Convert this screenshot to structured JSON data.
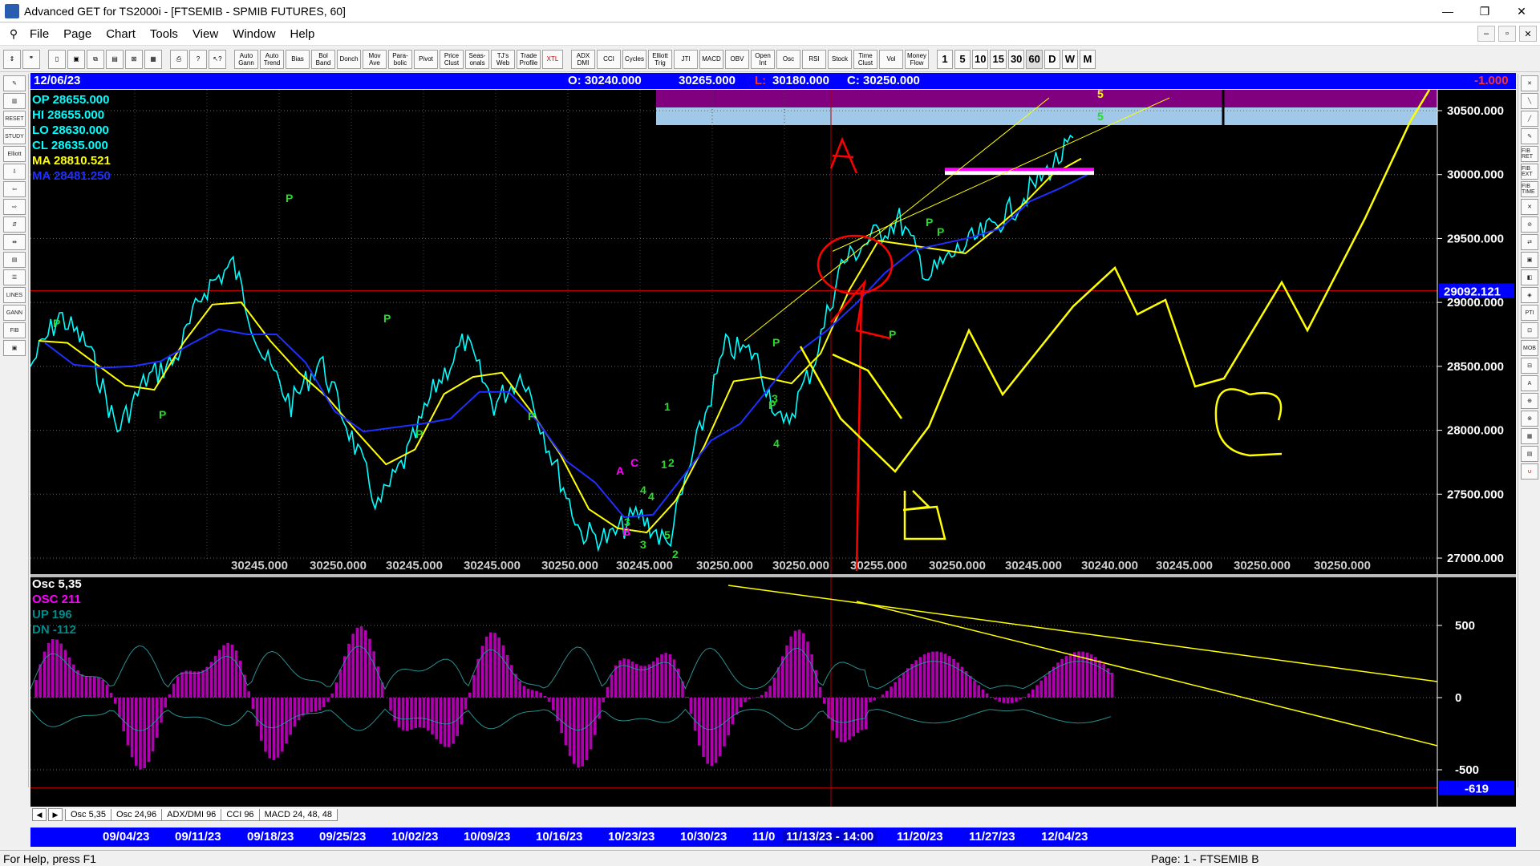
{
  "window": {
    "title": "Advanced GET for TS2000i - [FTSEMIB - SPMIB FUTURES, 60]",
    "buttons": [
      "—",
      "❐",
      "✕"
    ]
  },
  "menu": {
    "items": [
      "File",
      "Page",
      "Chart",
      "Tools",
      "View",
      "Window",
      "Help"
    ],
    "mdi_buttons": [
      "–",
      "▫",
      "✕"
    ]
  },
  "toolbar": {
    "buttons": [
      "Auto Gann",
      "Auto Trend",
      "Bias",
      "Bol Band",
      "Donch",
      "Mov Ave",
      "Para-bolic",
      "Pivot",
      "Price Clust",
      "Seas-onals",
      "TJ's Web",
      "Trade Profile",
      "XTL",
      "ADX DMI",
      "CCI",
      "Cycles",
      "Elliott Trig",
      "JTI",
      "MACD",
      "OBV",
      "Open Int",
      "Osc",
      "RSI",
      "Stock",
      "Time Clust",
      "Vol",
      "Money Flow"
    ],
    "intervals": [
      "1",
      "5",
      "10",
      "15",
      "30",
      "60",
      "D",
      "W",
      "M"
    ],
    "active_interval": "60"
  },
  "left_tools": [
    "RESET",
    "STUDY",
    "Elliott",
    "LINES",
    "GANN",
    "FIB"
  ],
  "right_tools": [
    "FIB RET",
    "FIB EXT",
    "FIB TIME",
    "PTI",
    "MOB",
    "A"
  ],
  "header": {
    "date": "12/06/23",
    "open": "O: 30240.000",
    "high": "30265.000",
    "low_label": "L:",
    "low": "30180.000",
    "close": "C: 30250.000",
    "change": "-1.000"
  },
  "readouts": {
    "op": "OP 28655.000",
    "hi": "HI  28655.000",
    "lo": "LO  28630.000",
    "cl": "CL  28635.000",
    "ma1": "MA  28810.521",
    "ma2": "MA  28481.250"
  },
  "price_axis": {
    "labels": [
      "30500.000",
      "30000.000",
      "29500.000",
      "29000.000",
      "28500.000",
      "28000.000",
      "27500.000",
      "27000.000"
    ],
    "values": [
      30500,
      30000,
      29500,
      29000,
      28500,
      28000,
      27500,
      27000
    ],
    "marker": "29092.121",
    "marker_value": 29092.121
  },
  "bottom_values": [
    "30245.000",
    "30250.000",
    "30245.000",
    "30245.000",
    "30250.000",
    "30245.000",
    "30250.000",
    "30250.000",
    "30255.000",
    "30250.000",
    "30245.000",
    "30240.000",
    "30245.000",
    "30250.000",
    "30250.000"
  ],
  "pivots": [
    "P",
    "P",
    "P",
    "P",
    "P",
    "P",
    "P",
    "P",
    "P",
    "P",
    "P"
  ],
  "wave_labels": [
    "1",
    "2",
    "3",
    "4",
    "5",
    "3",
    "4",
    "1",
    "2",
    "3",
    "4"
  ],
  "abc_labels": [
    "A",
    "B",
    "C"
  ],
  "osc": {
    "title": "Osc 5,35",
    "osc": "OSC 211",
    "up": "UP   196",
    "dn": "DN   -112",
    "axis_labels": [
      "500",
      "0",
      "-500"
    ],
    "axis_values": [
      500,
      0,
      -500
    ],
    "current": "-619"
  },
  "tabs": [
    "Osc 5,35",
    "Osc 24,96",
    "ADX/DMI 96",
    "CCI 96",
    "MACD 24, 48, 48"
  ],
  "dates": [
    "09/04/23",
    "09/11/23",
    "09/18/23",
    "09/25/23",
    "10/02/23",
    "10/09/23",
    "10/16/23",
    "10/23/23",
    "10/30/23",
    "11/0",
    "11/13/23 - 14:00",
    "11/20/23",
    "11/27/23",
    "12/04/23"
  ],
  "status": {
    "help": "For Help, press F1",
    "page": "Page: 1 - FTSEMIB B"
  },
  "colors": {
    "price": "#00ffff",
    "ma_fast": "#ffff00",
    "ma_slow": "#1e2fff",
    "osc": "#b000b0",
    "band": "#a0c8e8",
    "band_top": "#800080",
    "green": "#22dd22",
    "magenta": "#ff00ff",
    "annotation_red": "#ff0000",
    "annotation_yellow": "#ffff00"
  },
  "chart_data": {
    "type": "line",
    "series": [
      {
        "values": [
          28500,
          28900,
          28650,
          28000,
          28400,
          28550,
          29100,
          29300,
          28600,
          28200,
          28550,
          28000,
          27400,
          27800,
          28350,
          28700,
          28200,
          28450,
          27800,
          27200,
          27150,
          27350,
          27100,
          27900,
          28650,
          28600,
          28000,
          28500,
          29300,
          29500,
          29650,
          29200,
          29400,
          29550,
          29750,
          30000,
          30250
        ]
      }
    ],
    "ylim": [
      26950,
      30600
    ]
  }
}
